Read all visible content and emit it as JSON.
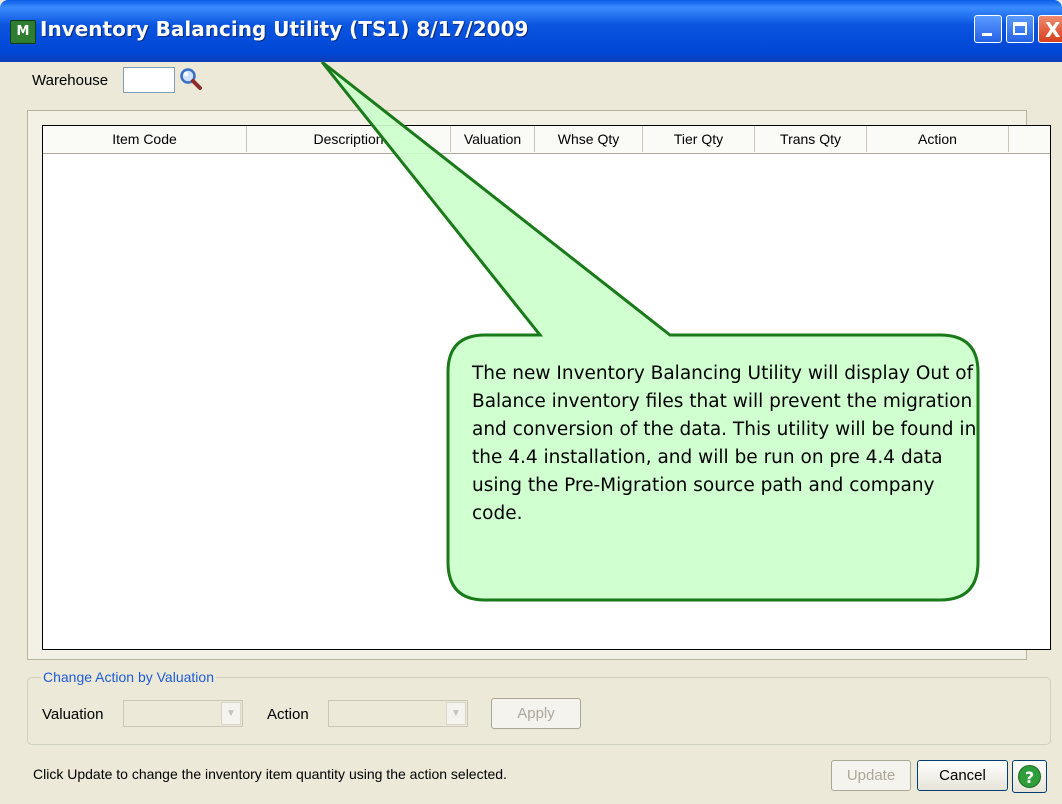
{
  "window": {
    "title": "Inventory Balancing Utility (TS1) 8/17/2009",
    "app_icon_text": "M",
    "controls": {
      "minimize": "minimize-icon",
      "maximize": "maximize-icon",
      "close": "close-icon",
      "close_glyph": "X"
    }
  },
  "warehouse": {
    "label": "Warehouse",
    "value": "",
    "lookup_icon": "magnifier-icon"
  },
  "grid": {
    "columns": [
      "Item Code",
      "Description",
      "Valuation",
      "Whse Qty",
      "Tier Qty",
      "Trans Qty",
      "Action"
    ],
    "rows": []
  },
  "callout": {
    "text": "The new Inventory Balancing Utility will display Out of Balance inventory files that will prevent the migration and conversion of the data. This utility will be found in the 4.4 installation, and will be run on pre 4.4 data using the Pre-Migration source path and company code.",
    "fill": "#ccffcc",
    "border": "#1a7a1a"
  },
  "change_action": {
    "legend": "Change Action by Valuation",
    "valuation_label": "Valuation",
    "valuation_value": "",
    "action_label": "Action",
    "action_value": "",
    "apply_label": "Apply"
  },
  "footer": {
    "status": "Click Update to change the inventory item quantity using the action selected.",
    "update_label": "Update",
    "cancel_label": "Cancel",
    "help_glyph": "?"
  },
  "colors": {
    "title_bar": "#0a55e0",
    "window_bg": "#ece9d8",
    "legend_text": "#1e5bd6"
  }
}
